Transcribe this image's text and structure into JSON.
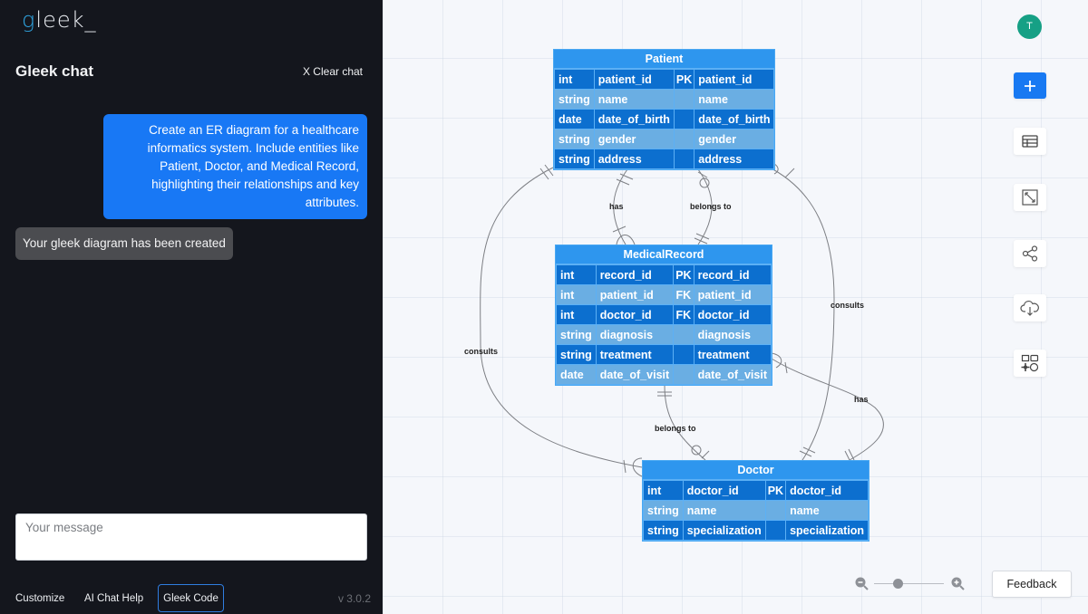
{
  "sidebar": {
    "logo": {
      "first": "g",
      "rest": "leek_"
    },
    "chat_title": "Gleek chat",
    "clear_chat_label": "X Clear chat",
    "messages": [
      {
        "role": "user",
        "text": "Create an ER diagram for a healthcare informatics system. Include entities like Patient, Doctor, and Medical Record, highlighting their relationships and key attributes."
      },
      {
        "role": "assistant",
        "text": "Your gleek diagram has been created"
      }
    ],
    "input": {
      "placeholder": "Your message",
      "value": ""
    },
    "footer": {
      "customize_label": "Customize",
      "ai_chat_help_label": "AI Chat Help",
      "gleek_code_label": "Gleek Code",
      "version": "v 3.0.2"
    }
  },
  "diagram": {
    "entities": [
      {
        "name": "Patient",
        "rows": [
          {
            "type": "int",
            "field": "patient_id",
            "key": "PK",
            "alias": "patient_id"
          },
          {
            "type": "string",
            "field": "name",
            "key": "",
            "alias": "name"
          },
          {
            "type": "date",
            "field": "date_of_birth",
            "key": "",
            "alias": "date_of_birth"
          },
          {
            "type": "string",
            "field": "gender",
            "key": "",
            "alias": "gender"
          },
          {
            "type": "string",
            "field": "address",
            "key": "",
            "alias": "address"
          }
        ]
      },
      {
        "name": "MedicalRecord",
        "rows": [
          {
            "type": "int",
            "field": "record_id",
            "key": "PK",
            "alias": "record_id"
          },
          {
            "type": "int",
            "field": "patient_id",
            "key": "FK",
            "alias": "patient_id"
          },
          {
            "type": "int",
            "field": "doctor_id",
            "key": "FK",
            "alias": "doctor_id"
          },
          {
            "type": "string",
            "field": "diagnosis",
            "key": "",
            "alias": "diagnosis"
          },
          {
            "type": "string",
            "field": "treatment",
            "key": "",
            "alias": "treatment"
          },
          {
            "type": "date",
            "field": "date_of_visit",
            "key": "",
            "alias": "date_of_visit"
          }
        ]
      },
      {
        "name": "Doctor",
        "rows": [
          {
            "type": "int",
            "field": "doctor_id",
            "key": "PK",
            "alias": "doctor_id"
          },
          {
            "type": "string",
            "field": "name",
            "key": "",
            "alias": "name"
          },
          {
            "type": "string",
            "field": "specialization",
            "key": "",
            "alias": "specialization"
          }
        ]
      }
    ],
    "relationships": [
      {
        "from": "Patient",
        "to": "MedicalRecord",
        "label": "has"
      },
      {
        "from": "MedicalRecord",
        "to": "Patient",
        "label": "belongs to"
      },
      {
        "from": "Patient",
        "to": "Doctor",
        "label": "consults"
      },
      {
        "from": "Doctor",
        "to": "Patient",
        "label": "consults"
      },
      {
        "from": "MedicalRecord",
        "to": "Doctor",
        "label": "belongs to"
      },
      {
        "from": "Doctor",
        "to": "MedicalRecord",
        "label": "has"
      }
    ]
  },
  "toolbar": {
    "avatar_initial": "T",
    "buttons": [
      {
        "name": "add",
        "icon": "plus-icon"
      },
      {
        "name": "table",
        "icon": "table-icon"
      },
      {
        "name": "fit",
        "icon": "expand-icon"
      },
      {
        "name": "share",
        "icon": "share-icon"
      },
      {
        "name": "download",
        "icon": "cloud-download-icon"
      },
      {
        "name": "shapes",
        "icon": "shapes-icon"
      }
    ]
  },
  "zoom": {
    "level_fraction": 0.35
  },
  "feedback_label": "Feedback",
  "colors": {
    "accent": "#1879f2",
    "entity_header": "#2e96ee",
    "row_dark": "#0c6fcf",
    "row_light": "#6aaee3",
    "sidebar_bg": "#14161d",
    "avatar": "#16a085"
  }
}
